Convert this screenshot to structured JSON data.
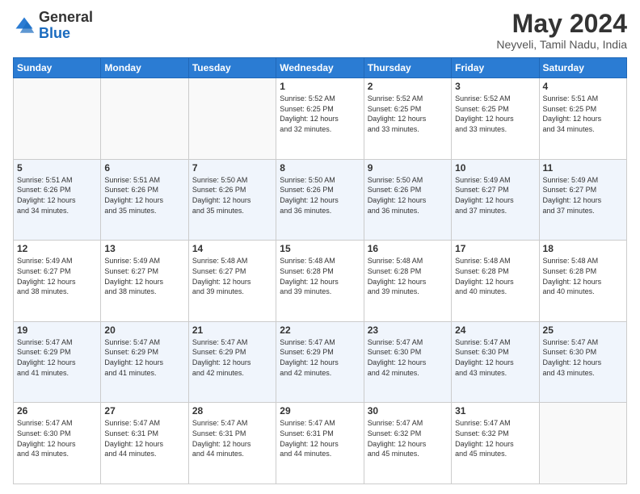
{
  "header": {
    "logo_line1": "General",
    "logo_line2": "Blue",
    "title": "May 2024",
    "location": "Neyveli, Tamil Nadu, India"
  },
  "days_of_week": [
    "Sunday",
    "Monday",
    "Tuesday",
    "Wednesday",
    "Thursday",
    "Friday",
    "Saturday"
  ],
  "weeks": [
    [
      {
        "day": "",
        "info": ""
      },
      {
        "day": "",
        "info": ""
      },
      {
        "day": "",
        "info": ""
      },
      {
        "day": "1",
        "info": "Sunrise: 5:52 AM\nSunset: 6:25 PM\nDaylight: 12 hours\nand 32 minutes."
      },
      {
        "day": "2",
        "info": "Sunrise: 5:52 AM\nSunset: 6:25 PM\nDaylight: 12 hours\nand 33 minutes."
      },
      {
        "day": "3",
        "info": "Sunrise: 5:52 AM\nSunset: 6:25 PM\nDaylight: 12 hours\nand 33 minutes."
      },
      {
        "day": "4",
        "info": "Sunrise: 5:51 AM\nSunset: 6:25 PM\nDaylight: 12 hours\nand 34 minutes."
      }
    ],
    [
      {
        "day": "5",
        "info": "Sunrise: 5:51 AM\nSunset: 6:26 PM\nDaylight: 12 hours\nand 34 minutes."
      },
      {
        "day": "6",
        "info": "Sunrise: 5:51 AM\nSunset: 6:26 PM\nDaylight: 12 hours\nand 35 minutes."
      },
      {
        "day": "7",
        "info": "Sunrise: 5:50 AM\nSunset: 6:26 PM\nDaylight: 12 hours\nand 35 minutes."
      },
      {
        "day": "8",
        "info": "Sunrise: 5:50 AM\nSunset: 6:26 PM\nDaylight: 12 hours\nand 36 minutes."
      },
      {
        "day": "9",
        "info": "Sunrise: 5:50 AM\nSunset: 6:26 PM\nDaylight: 12 hours\nand 36 minutes."
      },
      {
        "day": "10",
        "info": "Sunrise: 5:49 AM\nSunset: 6:27 PM\nDaylight: 12 hours\nand 37 minutes."
      },
      {
        "day": "11",
        "info": "Sunrise: 5:49 AM\nSunset: 6:27 PM\nDaylight: 12 hours\nand 37 minutes."
      }
    ],
    [
      {
        "day": "12",
        "info": "Sunrise: 5:49 AM\nSunset: 6:27 PM\nDaylight: 12 hours\nand 38 minutes."
      },
      {
        "day": "13",
        "info": "Sunrise: 5:49 AM\nSunset: 6:27 PM\nDaylight: 12 hours\nand 38 minutes."
      },
      {
        "day": "14",
        "info": "Sunrise: 5:48 AM\nSunset: 6:27 PM\nDaylight: 12 hours\nand 39 minutes."
      },
      {
        "day": "15",
        "info": "Sunrise: 5:48 AM\nSunset: 6:28 PM\nDaylight: 12 hours\nand 39 minutes."
      },
      {
        "day": "16",
        "info": "Sunrise: 5:48 AM\nSunset: 6:28 PM\nDaylight: 12 hours\nand 39 minutes."
      },
      {
        "day": "17",
        "info": "Sunrise: 5:48 AM\nSunset: 6:28 PM\nDaylight: 12 hours\nand 40 minutes."
      },
      {
        "day": "18",
        "info": "Sunrise: 5:48 AM\nSunset: 6:28 PM\nDaylight: 12 hours\nand 40 minutes."
      }
    ],
    [
      {
        "day": "19",
        "info": "Sunrise: 5:47 AM\nSunset: 6:29 PM\nDaylight: 12 hours\nand 41 minutes."
      },
      {
        "day": "20",
        "info": "Sunrise: 5:47 AM\nSunset: 6:29 PM\nDaylight: 12 hours\nand 41 minutes."
      },
      {
        "day": "21",
        "info": "Sunrise: 5:47 AM\nSunset: 6:29 PM\nDaylight: 12 hours\nand 42 minutes."
      },
      {
        "day": "22",
        "info": "Sunrise: 5:47 AM\nSunset: 6:29 PM\nDaylight: 12 hours\nand 42 minutes."
      },
      {
        "day": "23",
        "info": "Sunrise: 5:47 AM\nSunset: 6:30 PM\nDaylight: 12 hours\nand 42 minutes."
      },
      {
        "day": "24",
        "info": "Sunrise: 5:47 AM\nSunset: 6:30 PM\nDaylight: 12 hours\nand 43 minutes."
      },
      {
        "day": "25",
        "info": "Sunrise: 5:47 AM\nSunset: 6:30 PM\nDaylight: 12 hours\nand 43 minutes."
      }
    ],
    [
      {
        "day": "26",
        "info": "Sunrise: 5:47 AM\nSunset: 6:30 PM\nDaylight: 12 hours\nand 43 minutes."
      },
      {
        "day": "27",
        "info": "Sunrise: 5:47 AM\nSunset: 6:31 PM\nDaylight: 12 hours\nand 44 minutes."
      },
      {
        "day": "28",
        "info": "Sunrise: 5:47 AM\nSunset: 6:31 PM\nDaylight: 12 hours\nand 44 minutes."
      },
      {
        "day": "29",
        "info": "Sunrise: 5:47 AM\nSunset: 6:31 PM\nDaylight: 12 hours\nand 44 minutes."
      },
      {
        "day": "30",
        "info": "Sunrise: 5:47 AM\nSunset: 6:32 PM\nDaylight: 12 hours\nand 45 minutes."
      },
      {
        "day": "31",
        "info": "Sunrise: 5:47 AM\nSunset: 6:32 PM\nDaylight: 12 hours\nand 45 minutes."
      },
      {
        "day": "",
        "info": ""
      }
    ]
  ]
}
